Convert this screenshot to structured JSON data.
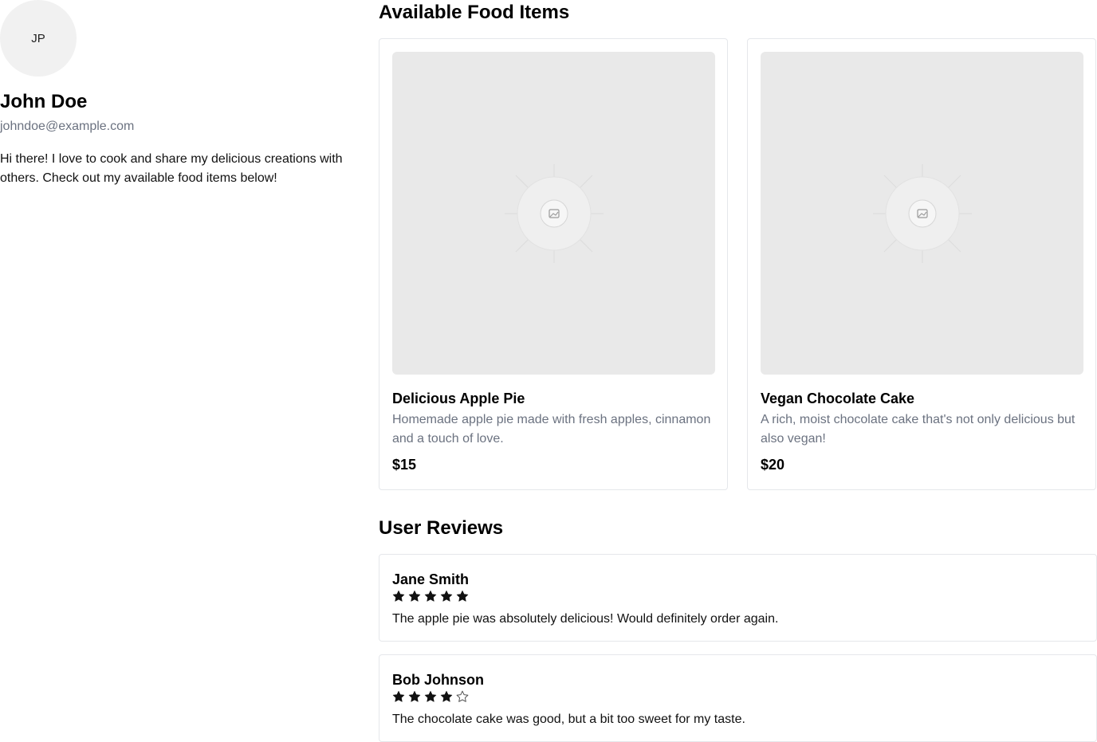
{
  "profile": {
    "initials": "JP",
    "name": "John Doe",
    "email": "johndoe@example.com",
    "bio": "Hi there! I love to cook and share my delicious creations with others. Check out my available food items below!"
  },
  "food_section": {
    "title": "Available Food Items",
    "items": [
      {
        "title": "Delicious Apple Pie",
        "description": "Homemade apple pie made with fresh apples, cinnamon and a touch of love.",
        "price": "$15",
        "image_icon": "image-placeholder-icon"
      },
      {
        "title": "Vegan Chocolate Cake",
        "description": "A rich, moist chocolate cake that's not only delicious but also vegan!",
        "price": "$20",
        "image_icon": "image-placeholder-icon"
      }
    ]
  },
  "reviews_section": {
    "title": "User Reviews",
    "reviews": [
      {
        "author": "Jane Smith",
        "rating": 5,
        "max_rating": 5,
        "text": "The apple pie was absolutely delicious! Would definitely order again."
      },
      {
        "author": "Bob Johnson",
        "rating": 4,
        "max_rating": 5,
        "text": "The chocolate cake was good, but a bit too sweet for my taste."
      }
    ]
  },
  "colors": {
    "muted_text": "#6b7280",
    "border": "#e5e7eb",
    "placeholder_bg": "#e9e9e9"
  }
}
